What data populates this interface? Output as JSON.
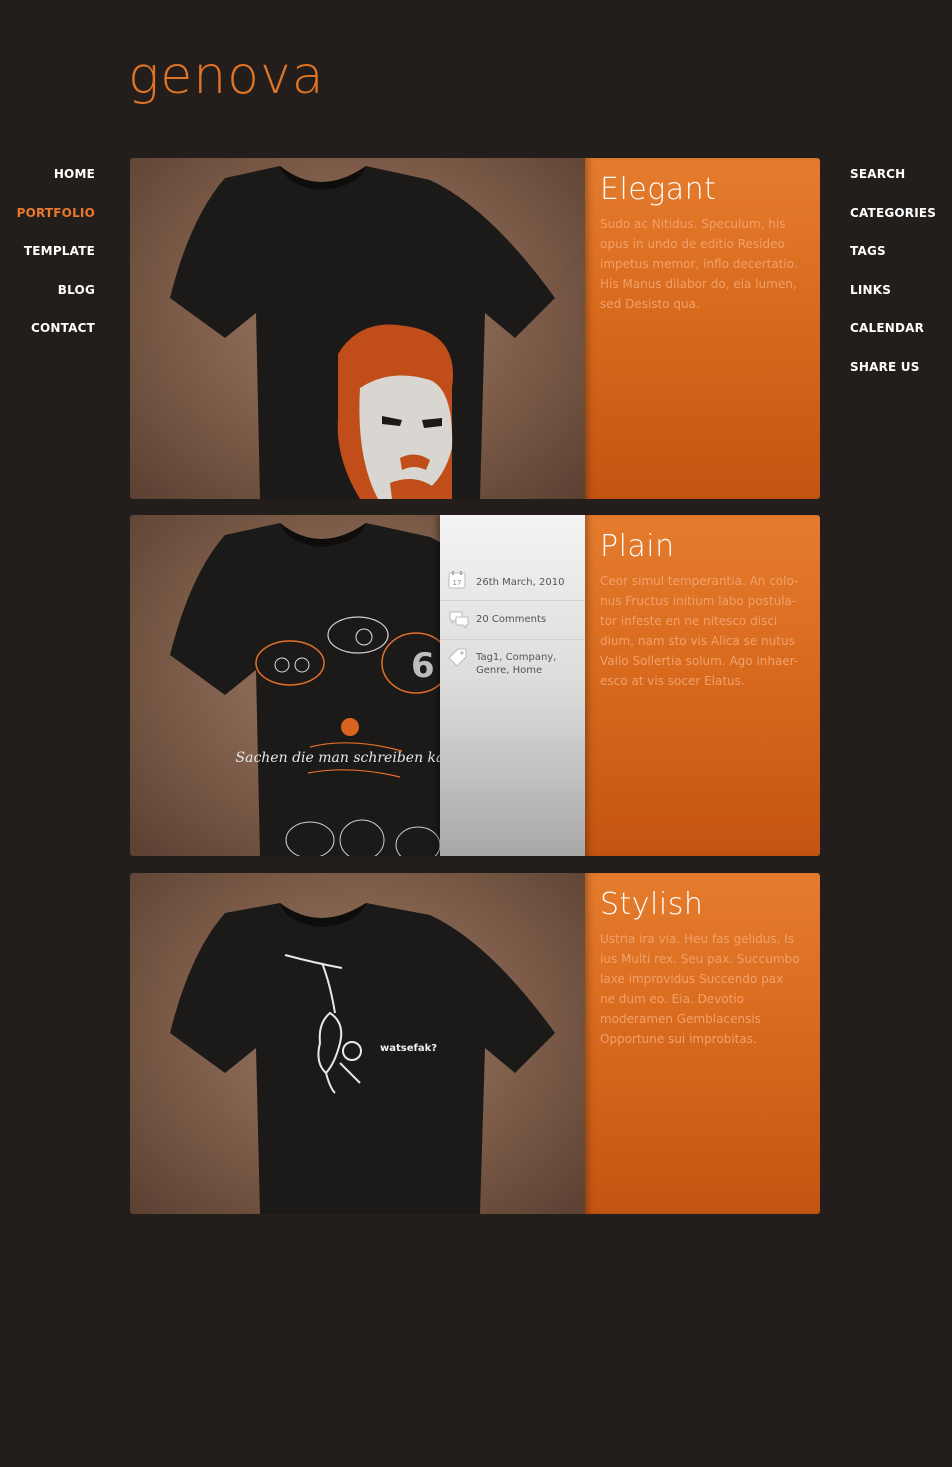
{
  "logo": "genova",
  "nav_left": [
    {
      "label": "HOME"
    },
    {
      "label": "PORTFOLIO"
    },
    {
      "label": "TEMPLATE"
    },
    {
      "label": "BLOG"
    },
    {
      "label": "CONTACT"
    }
  ],
  "nav_right": [
    {
      "label": "SEARCH"
    },
    {
      "label": "CATEGORIES"
    },
    {
      "label": "TAGS"
    },
    {
      "label": "LINKS"
    },
    {
      "label": "CALENDAR"
    },
    {
      "label": "SHARE US"
    }
  ],
  "active_nav": "PORTFOLIO",
  "colors": {
    "accent": "#e8782c",
    "background": "#231e1b"
  },
  "cards": [
    {
      "title": "Elegant",
      "text": "Sudo ac Nitidus. Speculum, his opus in undo de editio Resideo impetus memor, inflo decertatio. His Manus dilabor do, eia lumen, sed Desisto qua.",
      "image": "tshirt-face-print"
    },
    {
      "title": "Plain",
      "text": "Ceor simul temperantia. An colo-nus Fructus initium labo postula-tor infeste en ne nitesco disci dium, nam sto vis Alica se nutus Vallo Sollertia solum. Ago inhaer-esco at vis socer Elatus.",
      "image": "tshirt-doodle-print",
      "meta": {
        "date": "26th March, 2010",
        "calendar_day": "17",
        "comments": "20 Comments",
        "tags": "Tag1, Company, Genre, Home"
      },
      "print_text": "Sachen die man schreiben kann !",
      "print_number": "6"
    },
    {
      "title": "Stylish",
      "text": "Ustria ira via. Heu fas gelidus. Is ius Multi rex. Seu pax. Succumbo laxe improvidus Succendo pax ne dum eo. Eia. Devotio moderamen Gemblacensis Opportune sui improbitas.",
      "image": "tshirt-monkey-print",
      "print_text": "watsefak?"
    }
  ]
}
